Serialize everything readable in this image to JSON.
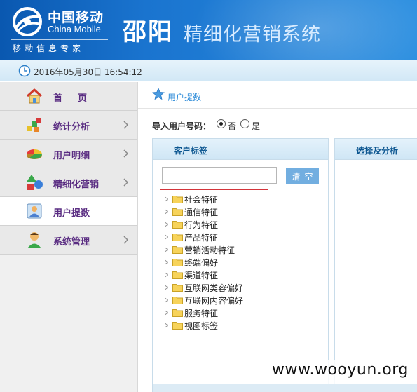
{
  "header": {
    "logo_cn": "中国移动",
    "logo_en": "China Mobile",
    "logo_slogan": "移动信息专家",
    "city": "邵阳",
    "app_title": "精细化营销系统"
  },
  "timebar": {
    "datetime": "2016年05月30日 16:54:12"
  },
  "sidebar": {
    "items": [
      {
        "label": "首页",
        "icon": "house-icon",
        "active": false,
        "has_arrow": false
      },
      {
        "label": "统计分析",
        "icon": "blocks-chart-icon",
        "active": false,
        "has_arrow": true
      },
      {
        "label": "用户明细",
        "icon": "pie-chart-icon",
        "active": false,
        "has_arrow": true
      },
      {
        "label": "精细化营销",
        "icon": "shapes-icon",
        "active": false,
        "has_arrow": true
      },
      {
        "label": "用户提数",
        "icon": "user-extract-icon",
        "active": true,
        "has_arrow": false
      },
      {
        "label": "系统管理",
        "icon": "admin-user-icon",
        "active": false,
        "has_arrow": true
      }
    ]
  },
  "breadcrumb": {
    "label": "用户提数",
    "icon": "star-icon"
  },
  "import": {
    "label": "导入用户号码：",
    "options": [
      {
        "label": "否",
        "checked": true
      },
      {
        "label": "是",
        "checked": false
      }
    ]
  },
  "left_panel": {
    "title": "客户标签",
    "search": {
      "value": "",
      "placeholder": ""
    },
    "clear_label": "清空",
    "tree": [
      "社会特征",
      "通信特征",
      "行为特征",
      "产品特征",
      "营销活动特征",
      "终端偏好",
      "渠道特征",
      "互联网类容偏好",
      "互联网内容偏好",
      "服务特征",
      "视图标签"
    ]
  },
  "right_panel": {
    "title": "选择及分析"
  },
  "watermark": "www.wooyun.org",
  "colors": {
    "header_blue": "#1a74cf",
    "nav_label": "#5a2d82",
    "panel_title": "#0c5690",
    "tree_border": "#d4343b",
    "clear_button": "#72aee0"
  }
}
